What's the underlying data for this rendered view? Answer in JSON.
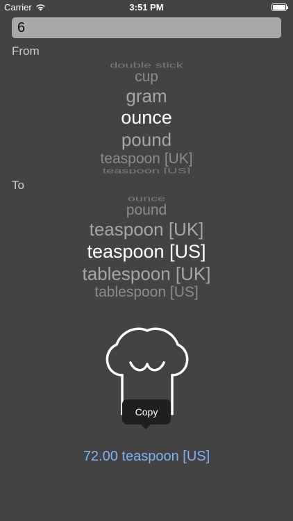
{
  "status": {
    "carrier": "Carrier",
    "time": "3:51 PM",
    "battery_level": 1.0
  },
  "amount_input": {
    "value": "6"
  },
  "from": {
    "label": "From",
    "items": [
      "double stick",
      "cup",
      "gram",
      "ounce",
      "pound",
      "teaspoon [UK]",
      "teaspoon [US]"
    ],
    "selected": "ounce"
  },
  "to": {
    "label": "To",
    "items": [
      "ounce",
      "pound",
      "teaspoon [UK]",
      "teaspoon [US]",
      "tablespoon [UK]",
      "tablespoon [US]"
    ],
    "selected": "teaspoon [US]"
  },
  "copy_tooltip": {
    "label": "Copy"
  },
  "result": {
    "text": "72.00 teaspoon [US]"
  },
  "colors": {
    "background": "#434343",
    "accent": "#7fb2f0",
    "input_bg": "#a9a9a9"
  },
  "icons": {
    "wifi": "wifi-icon",
    "battery": "battery-icon",
    "illustration": "chef-hat-icon"
  }
}
